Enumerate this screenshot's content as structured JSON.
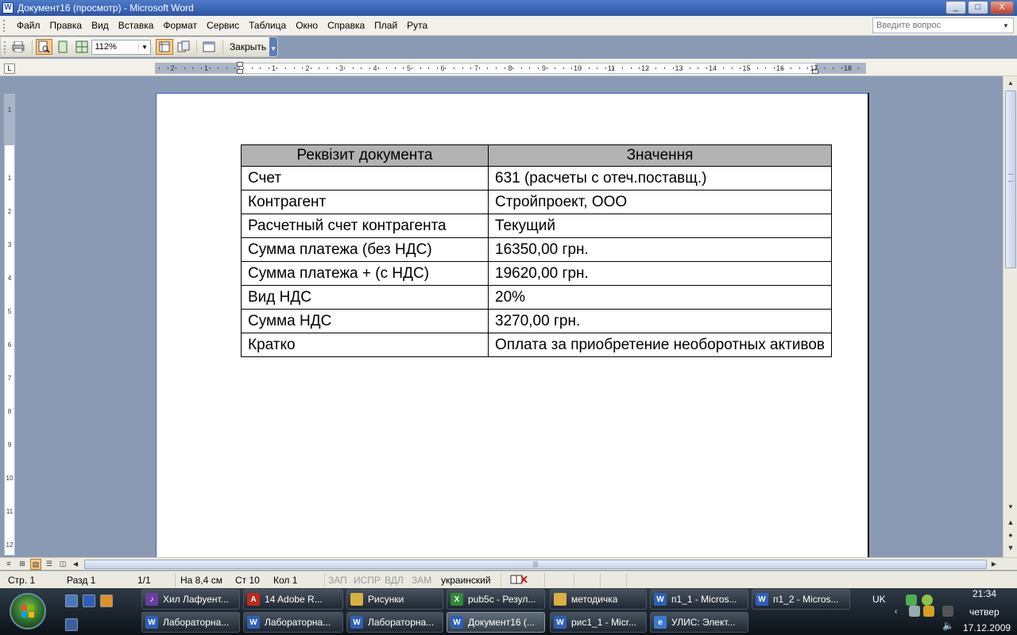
{
  "window": {
    "title": "Документ16 (просмотр) - Microsoft Word",
    "controls": [
      "_",
      "□",
      "X"
    ]
  },
  "menu": {
    "items": [
      "Файл",
      "Правка",
      "Вид",
      "Вставка",
      "Формат",
      "Сервис",
      "Таблица",
      "Окно",
      "Справка",
      "Плай",
      "Рута"
    ],
    "ask_placeholder": "Введите вопрос"
  },
  "toolbar": {
    "zoom": "112%",
    "close_label": "Закрыть"
  },
  "ruler": {
    "horizontal_ticks": [
      "2",
      "1",
      "1",
      "2",
      "3",
      "4",
      "5",
      "6",
      "7",
      "8",
      "9",
      "10",
      "11",
      "12",
      "13",
      "14",
      "15",
      "16",
      "17",
      "18"
    ],
    "vertical_ticks": [
      "1",
      "1",
      "2",
      "3",
      "4",
      "5",
      "6",
      "7",
      "8",
      "9",
      "10",
      "11",
      "12"
    ]
  },
  "document": {
    "table": {
      "headers": [
        "Реквізит документа",
        "Значення"
      ],
      "rows": [
        [
          "Счет",
          "631 (расчеты с отеч.поставщ.)"
        ],
        [
          "Контрагент",
          "Стройпроект, ООО"
        ],
        [
          "Расчетный счет контрагента",
          "Текущий"
        ],
        [
          "Сумма платежа (без НДС)",
          "16350,00 грн."
        ],
        [
          "Сумма платежа + (с НДС)",
          "19620,00 грн."
        ],
        [
          "Вид НДС",
          "20%"
        ],
        [
          "Сумма НДС",
          "3270,00 грн."
        ],
        [
          "Кратко",
          "Оплата за приобретение необоротных активов"
        ]
      ]
    }
  },
  "statusbar": {
    "page": "Стр. 1",
    "section": "Разд 1",
    "pages": "1/1",
    "position": "На 8,4 см",
    "line": "Ст 10",
    "column": "Кол 1",
    "rec": "ЗАП",
    "trk": "ИСПР",
    "ext": "ВДЛ",
    "ovr": "ЗАМ",
    "language": "украинский"
  },
  "taskbar": {
    "row1": [
      {
        "label": "Хил Лафуент...",
        "icon": "media-icon",
        "color": "#6a3fa0"
      },
      {
        "label": "14 Adobe R...",
        "icon": "pdf-icon",
        "color": "#c0281e"
      },
      {
        "label": "Рисунки",
        "icon": "folder-icon",
        "color": "#d8b040"
      },
      {
        "label": "pub5c - Резул...",
        "icon": "excel-icon",
        "color": "#2f8a3a"
      },
      {
        "label": "методичка",
        "icon": "folder-icon",
        "color": "#d8b040"
      },
      {
        "label": "п1_1 - Micros...",
        "icon": "word-icon",
        "color": "#2f5fb8"
      },
      {
        "label": "п1_2 - Micros...",
        "icon": "word-icon",
        "color": "#2f5fb8"
      }
    ],
    "row2": [
      {
        "label": "Лабораторна...",
        "icon": "word-icon",
        "color": "#2f5fb8"
      },
      {
        "label": "Лабораторна...",
        "icon": "word-icon",
        "color": "#2f5fb8"
      },
      {
        "label": "Лабораторна...",
        "icon": "word-icon",
        "color": "#2f5fb8"
      },
      {
        "label": "Документ16 (...",
        "icon": "word-icon",
        "color": "#2f5fb8"
      },
      {
        "label": "рис1_1 - Micr...",
        "icon": "word-icon",
        "color": "#2f5fb8"
      },
      {
        "label": "УЛИС: Элект...",
        "icon": "browser-icon",
        "color": "#3a7ad0"
      }
    ],
    "tray": {
      "language": "UK",
      "time": "21:34",
      "day": "четвер",
      "date": "17.12.2009"
    }
  }
}
